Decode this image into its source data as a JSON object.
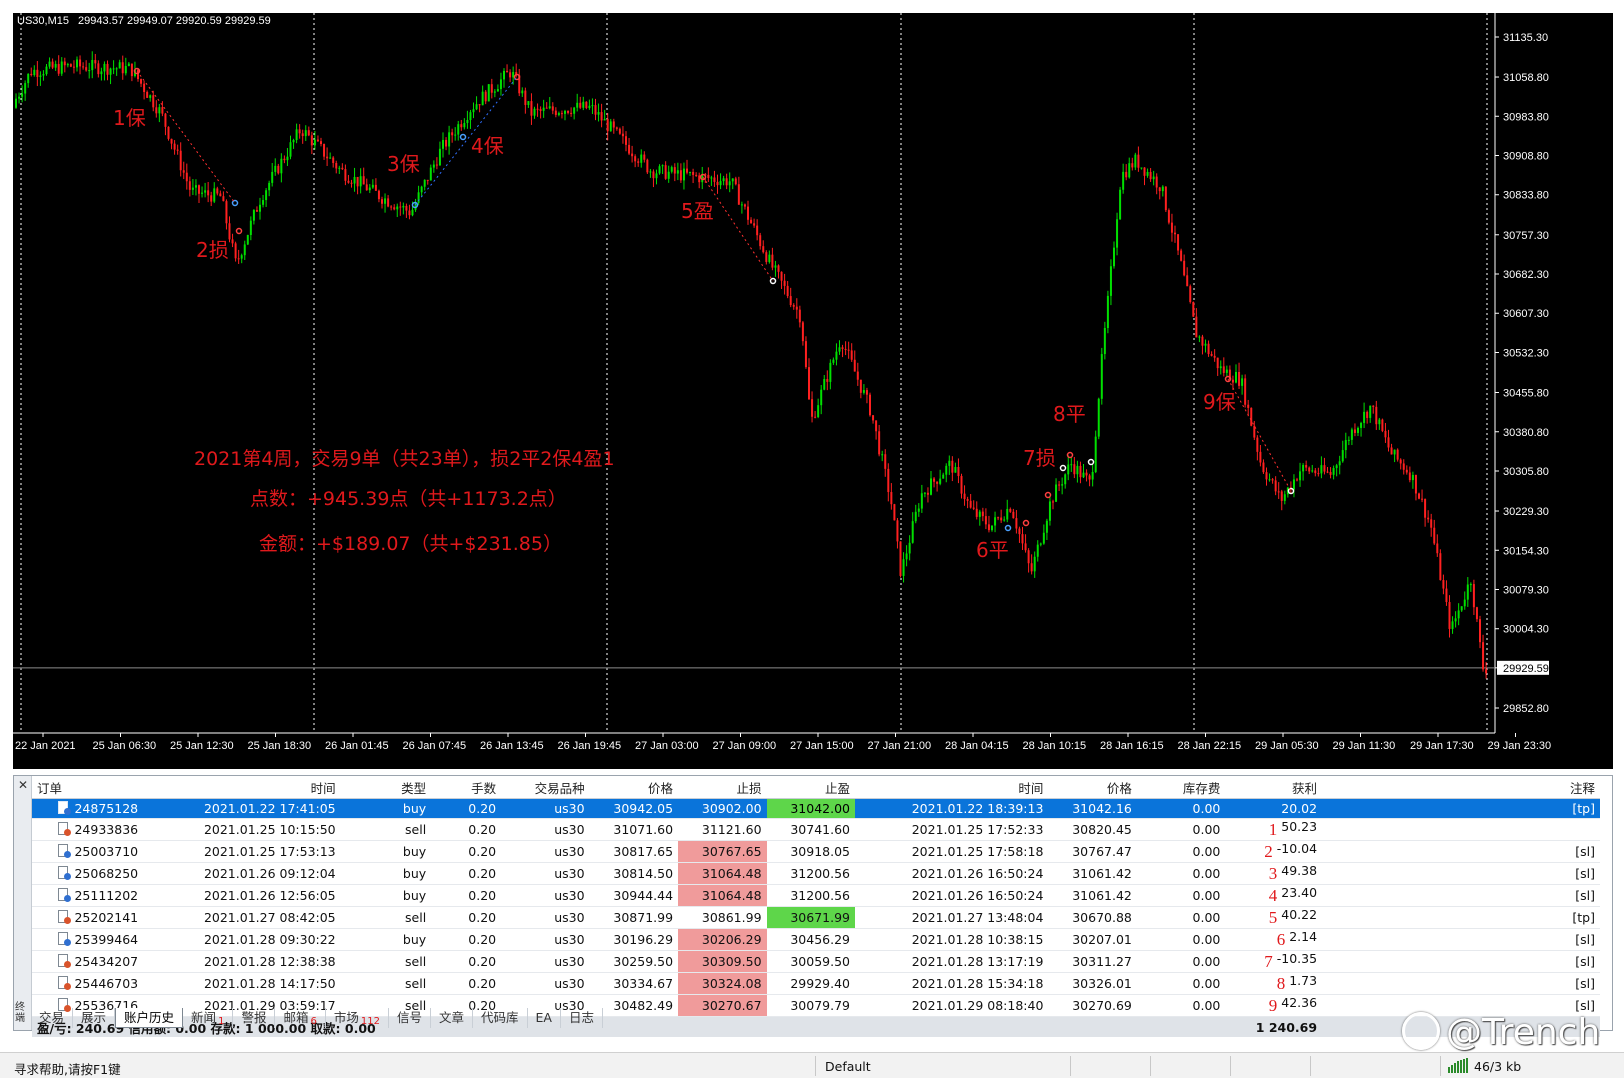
{
  "chart": {
    "symbol": "US30,M15",
    "ohlc": "29943.57 29949.07 29920.59 29929.59",
    "current_price": "29929.59",
    "price_ticks": [
      "31135.30",
      "31058.80",
      "30983.80",
      "30908.80",
      "30833.80",
      "30757.30",
      "30682.30",
      "30607.30",
      "30532.30",
      "30455.80",
      "30380.80",
      "30305.80",
      "30229.30",
      "30154.30",
      "30079.30",
      "30004.30",
      "29929.59",
      "29852.80"
    ],
    "time_ticks": [
      "22 Jan 2021",
      "25 Jan 06:30",
      "25 Jan 12:30",
      "25 Jan 18:30",
      "26 Jan 01:45",
      "26 Jan 07:45",
      "26 Jan 13:45",
      "26 Jan 19:45",
      "27 Jan 03:00",
      "27 Jan 09:00",
      "27 Jan 15:00",
      "27 Jan 21:00",
      "28 Jan 04:15",
      "28 Jan 10:15",
      "28 Jan 16:15",
      "28 Jan 22:15",
      "29 Jan 05:30",
      "29 Jan 11:30",
      "29 Jan 17:30",
      "29 Jan 23:30"
    ],
    "trade_labels": [
      "1保",
      "2损",
      "3保",
      "4保",
      "5盈",
      "6平",
      "7损",
      "8平",
      "9保"
    ],
    "summary_lines": [
      "2021第4周，交易9单（共23单），损2平2保4盈1",
      "点数：+945.39点（共+1173.2点）",
      "金额：+$189.07（共+$231.85）"
    ]
  },
  "columns": [
    "订单",
    "时间",
    "类型",
    "手数",
    "交易品种",
    "价格",
    "止损",
    "止盈",
    "时间",
    "价格",
    "库存费",
    "获利",
    "注释"
  ],
  "rows": [
    {
      "order": "24875128",
      "open_time": "2021.01.22 17:41:05",
      "type": "buy",
      "lots": "0.20",
      "symbol": "us30",
      "price": "30942.05",
      "sl": "30902.00",
      "tp": "31042.00",
      "close_time": "2021.01.22 18:39:13",
      "close_price": "31042.16",
      "swap": "0.00",
      "note": "",
      "profit": "20.02",
      "comment": "[tp]"
    },
    {
      "order": "24933836",
      "open_time": "2021.01.25 10:15:50",
      "type": "sell",
      "lots": "0.20",
      "symbol": "us30",
      "price": "31071.60",
      "sl": "31121.60",
      "tp": "30741.60",
      "close_time": "2021.01.25 17:52:33",
      "close_price": "30820.45",
      "swap": "0.00",
      "note": "1",
      "profit": "50.23",
      "comment": ""
    },
    {
      "order": "25003710",
      "open_time": "2021.01.25 17:53:13",
      "type": "buy",
      "lots": "0.20",
      "symbol": "us30",
      "price": "30817.65",
      "sl": "30767.65",
      "tp": "30918.05",
      "close_time": "2021.01.25 17:58:18",
      "close_price": "30767.47",
      "swap": "0.00",
      "note": "2",
      "profit": "-10.04",
      "comment": "[sl]"
    },
    {
      "order": "25068250",
      "open_time": "2021.01.26 09:12:04",
      "type": "buy",
      "lots": "0.20",
      "symbol": "us30",
      "price": "30814.50",
      "sl": "31064.48",
      "tp": "31200.56",
      "close_time": "2021.01.26 16:50:24",
      "close_price": "31061.42",
      "swap": "0.00",
      "note": "3",
      "profit": "49.38",
      "comment": "[sl]"
    },
    {
      "order": "25111202",
      "open_time": "2021.01.26 12:56:05",
      "type": "buy",
      "lots": "0.20",
      "symbol": "us30",
      "price": "30944.44",
      "sl": "31064.48",
      "tp": "31200.56",
      "close_time": "2021.01.26 16:50:24",
      "close_price": "31061.42",
      "swap": "0.00",
      "note": "4",
      "profit": "23.40",
      "comment": "[sl]"
    },
    {
      "order": "25202141",
      "open_time": "2021.01.27 08:42:05",
      "type": "sell",
      "lots": "0.20",
      "symbol": "us30",
      "price": "30871.99",
      "sl": "30861.99",
      "tp": "30671.99",
      "close_time": "2021.01.27 13:48:04",
      "close_price": "30670.88",
      "swap": "0.00",
      "note": "5",
      "profit": "40.22",
      "comment": "[tp]"
    },
    {
      "order": "25399464",
      "open_time": "2021.01.28 09:30:22",
      "type": "buy",
      "lots": "0.20",
      "symbol": "us30",
      "price": "30196.29",
      "sl": "30206.29",
      "tp": "30456.29",
      "close_time": "2021.01.28 10:38:15",
      "close_price": "30207.01",
      "swap": "0.00",
      "note": "6",
      "profit": "2.14",
      "comment": "[sl]"
    },
    {
      "order": "25434207",
      "open_time": "2021.01.28 12:38:38",
      "type": "sell",
      "lots": "0.20",
      "symbol": "us30",
      "price": "30259.50",
      "sl": "30309.50",
      "tp": "30059.50",
      "close_time": "2021.01.28 13:17:19",
      "close_price": "30311.27",
      "swap": "0.00",
      "note": "7",
      "profit": "-10.35",
      "comment": "[sl]"
    },
    {
      "order": "25446703",
      "open_time": "2021.01.28 14:17:50",
      "type": "sell",
      "lots": "0.20",
      "symbol": "us30",
      "price": "30334.67",
      "sl": "30324.08",
      "tp": "29929.40",
      "close_time": "2021.01.28 15:34:18",
      "close_price": "30326.01",
      "swap": "0.00",
      "note": "8",
      "profit": "1.73",
      "comment": "[sl]"
    },
    {
      "order": "25536716",
      "open_time": "2021.01.29 03:59:17",
      "type": "sell",
      "lots": "0.20",
      "symbol": "us30",
      "price": "30482.49",
      "sl": "30270.67",
      "tp": "30079.79",
      "close_time": "2021.01.29 08:18:40",
      "close_price": "30270.69",
      "swap": "0.00",
      "note": "9",
      "profit": "42.36",
      "comment": "[sl]"
    }
  ],
  "summary": {
    "text": "盈/亏: 240.69  信用额: 0.00  存款: 1 000.00  取款: 0.00",
    "total": "1 240.69"
  },
  "tabs": [
    {
      "label": "交易",
      "badge": ""
    },
    {
      "label": "展示",
      "badge": ""
    },
    {
      "label": "账户历史",
      "badge": "",
      "active": true
    },
    {
      "label": "新闻",
      "badge": "1"
    },
    {
      "label": "警报",
      "badge": ""
    },
    {
      "label": "邮箱",
      "badge": "6"
    },
    {
      "label": "市场",
      "badge": "112"
    },
    {
      "label": "信号",
      "badge": ""
    },
    {
      "label": "文章",
      "badge": ""
    },
    {
      "label": "代码库",
      "badge": ""
    },
    {
      "label": "EA",
      "badge": ""
    },
    {
      "label": "日志",
      "badge": ""
    }
  ],
  "side_label": "终端",
  "status": {
    "help": "寻求帮助,请按F1键",
    "profile": "Default",
    "traffic": "46/3 kb"
  },
  "watermark": "@Trench",
  "colors": {
    "bull": "#00e000",
    "bear": "#ff2020",
    "label": "#e0191c",
    "selected": "#0a74da",
    "sl_cell": "#f09b9b",
    "tp_cell": "#5ed64a"
  }
}
